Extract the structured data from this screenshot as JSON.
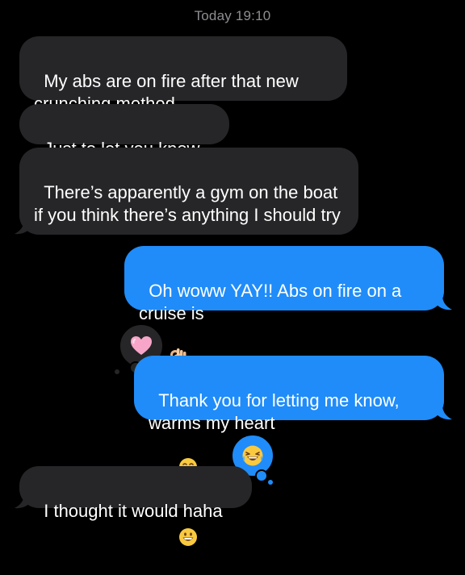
{
  "header": {
    "timestamp": "Today 19:10"
  },
  "messages": [
    {
      "direction": "incoming",
      "text": "My abs are on fire after that new crunching method"
    },
    {
      "direction": "incoming",
      "text": "Just to let you know"
    },
    {
      "direction": "incoming",
      "text": "There’s apparently a gym on the boat if you think there’s anything I should try"
    },
    {
      "direction": "outgoing",
      "text": "Oh woww YAY!! Abs on fire on a cruise is",
      "emoji": [
        "ok-hand"
      ]
    },
    {
      "direction": "outgoing",
      "text": "Thank you for letting me know, warms my heart",
      "emoji": [
        "smiling-face",
        "grinning-face"
      ],
      "tapback": "heart"
    },
    {
      "direction": "incoming",
      "text": "I thought it would haha",
      "tapback": "laughing-face"
    }
  ],
  "colors": {
    "background": "#000000",
    "incoming_bubble": "#262628",
    "outgoing_bubble": "#1f8cf9",
    "timestamp": "#8e8e93",
    "heart": "#f7a6c9"
  }
}
